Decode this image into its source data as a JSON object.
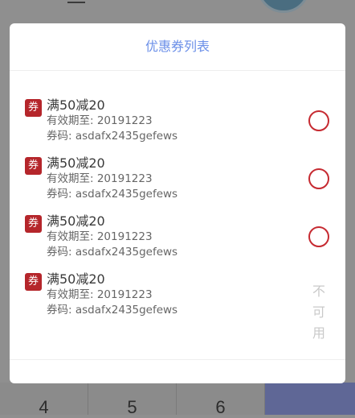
{
  "background": {
    "keypad": [
      "4",
      "5",
      "6",
      ""
    ]
  },
  "modal": {
    "title": "优惠券列表",
    "badge_text": "券",
    "coupons": [
      {
        "name": "满50减20",
        "expiry": "有效期至: 20191223",
        "code": "券码: asdafx2435gefews",
        "selectable": true
      },
      {
        "name": "满50减20",
        "expiry": "有效期至: 20191223",
        "code": "券码: asdafx2435gefews",
        "selectable": true
      },
      {
        "name": "满50减20",
        "expiry": "有效期至: 20191223",
        "code": "券码: asdafx2435gefews",
        "selectable": true
      },
      {
        "name": "满50减20",
        "expiry": "有效期至: 20191223",
        "code": "券码: asdafx2435gefews",
        "selectable": false,
        "status": "不可用"
      }
    ]
  },
  "colors": {
    "title": "#6b8fe8",
    "badge": "#b5262b",
    "radio": "#c62a31",
    "disabled": "#c9c9c9",
    "accent_key": "#5f6796"
  }
}
